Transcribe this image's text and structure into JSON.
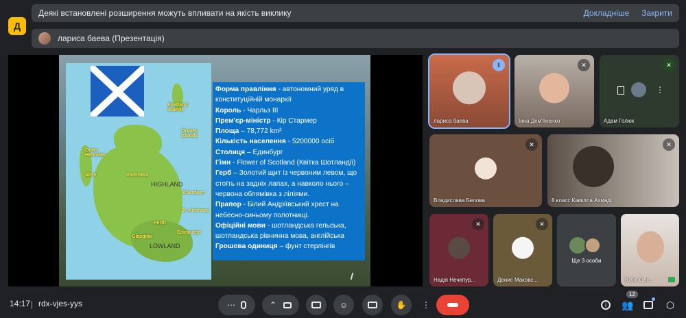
{
  "notice": {
    "message": "Деякі встановлені розширення можуть впливати на якість виклику",
    "details": "Докладніше",
    "close": "Закрити"
  },
  "app_icon": {
    "glyph": "Д"
  },
  "presenter": {
    "label": "лариса баева (Презентація)"
  },
  "slide": {
    "map_labels": {
      "shetland": "Shetland Islands",
      "orkney": "Orkney Islands",
      "outer_hebrides": "Outer Hebrides",
      "skye": "Skye",
      "inverness": "Inverness",
      "highland": "HIGHLAND",
      "aberdeen": "Aberdeen",
      "st_andrews": "St. Andrews",
      "perth": "Perth",
      "edinburgh": "Edinburgh",
      "glasgow": "Glasgow",
      "lowland": "LOWLAND"
    },
    "info": [
      {
        "key": "Форма правління",
        "sep": " - ",
        "value": "автономний уряд в конституційній монархії"
      },
      {
        "key": "Король",
        "sep": " - ",
        "value": "Чарльз III"
      },
      {
        "key": "Прем'єр-міністр",
        "sep": " - ",
        "value": "Кір Стармер"
      },
      {
        "key": "Площа",
        "sep": " – ",
        "value": "78,772 km²"
      },
      {
        "key": "Кількість населення",
        "sep": " - ",
        "value": "5200000 осіб"
      },
      {
        "key": "Столиця",
        "sep": " – ",
        "value": "Единбург"
      },
      {
        "key": "Гімн",
        "sep": " - ",
        "value": "Flower of Scotland (Квітка Шотландії)"
      },
      {
        "key": "Герб",
        "sep": " – ",
        "value": "Золотий щит із червоним левом, що стоїть на задніх лапах, а навколо нього – червона облямівка з ліліями."
      },
      {
        "key": "Прапор",
        "sep": " - ",
        "value": "Білий Андріївський хрест на небесно-синьому полотнищі."
      },
      {
        "key": "Офіційні мови",
        "sep": " - ",
        "value": "шотландська гельська, шотландська рівнинна мова, англійська"
      },
      {
        "key": "Грошова одиниця",
        "sep": " – ",
        "value": "фунт стерлінгів"
      }
    ]
  },
  "participants": [
    {
      "name": "лариса баева",
      "speaking": true
    },
    {
      "name": "Інна Дем'яненко",
      "muted": true
    },
    {
      "name": "Адам Голюк",
      "muted": true
    },
    {
      "name": "Владислава Белова",
      "muted": true
    },
    {
      "name": "8 класс Камілла Ахмаді",
      "muted": true
    },
    {
      "name": "Надія Нечепур...",
      "muted": true
    },
    {
      "name": "Денис Маковс...",
      "muted": true
    },
    {
      "name": "Ще 3 особи"
    },
    {
      "name": "Юлія Оле..."
    }
  ],
  "footer": {
    "time": "14:17",
    "meeting_code": "rdx-vjes-yys",
    "people_count": "12"
  },
  "colors": {
    "background": "#202124",
    "accent": "#8ab4f8",
    "end_call": "#ea4335",
    "slide_box": "#0d73c9"
  }
}
